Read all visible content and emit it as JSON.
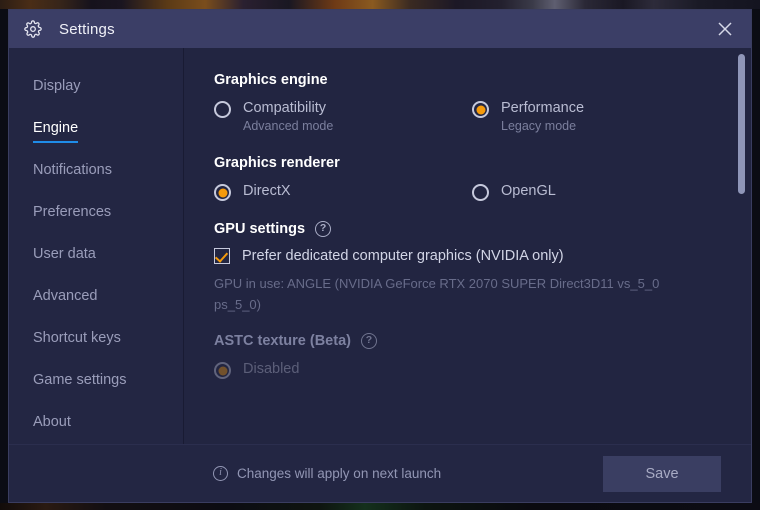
{
  "window": {
    "title": "Settings",
    "gear_icon": "gear-icon",
    "close_icon": "close-icon"
  },
  "sidebar": {
    "items": [
      {
        "label": "Display",
        "active": false
      },
      {
        "label": "Engine",
        "active": true
      },
      {
        "label": "Notifications",
        "active": false
      },
      {
        "label": "Preferences",
        "active": false
      },
      {
        "label": "User data",
        "active": false
      },
      {
        "label": "Advanced",
        "active": false
      },
      {
        "label": "Shortcut keys",
        "active": false
      },
      {
        "label": "Game settings",
        "active": false
      },
      {
        "label": "About",
        "active": false
      }
    ]
  },
  "content": {
    "graphics_engine": {
      "heading": "Graphics engine",
      "options": [
        {
          "label": "Compatibility",
          "sub": "Advanced mode",
          "selected": false
        },
        {
          "label": "Performance",
          "sub": "Legacy mode",
          "selected": true
        }
      ]
    },
    "graphics_renderer": {
      "heading": "Graphics renderer",
      "options": [
        {
          "label": "DirectX",
          "selected": true
        },
        {
          "label": "OpenGL",
          "selected": false
        }
      ]
    },
    "gpu_settings": {
      "heading": "GPU settings",
      "help_icon": "help-icon",
      "checkbox_label": "Prefer dedicated computer graphics (NVIDIA only)",
      "checkbox_checked": true,
      "gpu_in_use": "GPU in use: ANGLE (NVIDIA GeForce RTX 2070 SUPER Direct3D11 vs_5_0 ps_5_0)"
    },
    "astc_texture": {
      "heading": "ASTC texture (Beta)",
      "help_icon": "help-icon",
      "options": [
        {
          "label": "Disabled",
          "selected": true
        }
      ]
    }
  },
  "footer": {
    "info_icon": "info-icon",
    "note": "Changes will apply on next launch",
    "save_label": "Save"
  },
  "colors": {
    "accent_orange": "#f59a0b",
    "active_underline_blue": "#1f8ce8",
    "titlebar": "#3b3e66",
    "dialog_bg": "#222541",
    "sidebar_bg": "#232643"
  }
}
